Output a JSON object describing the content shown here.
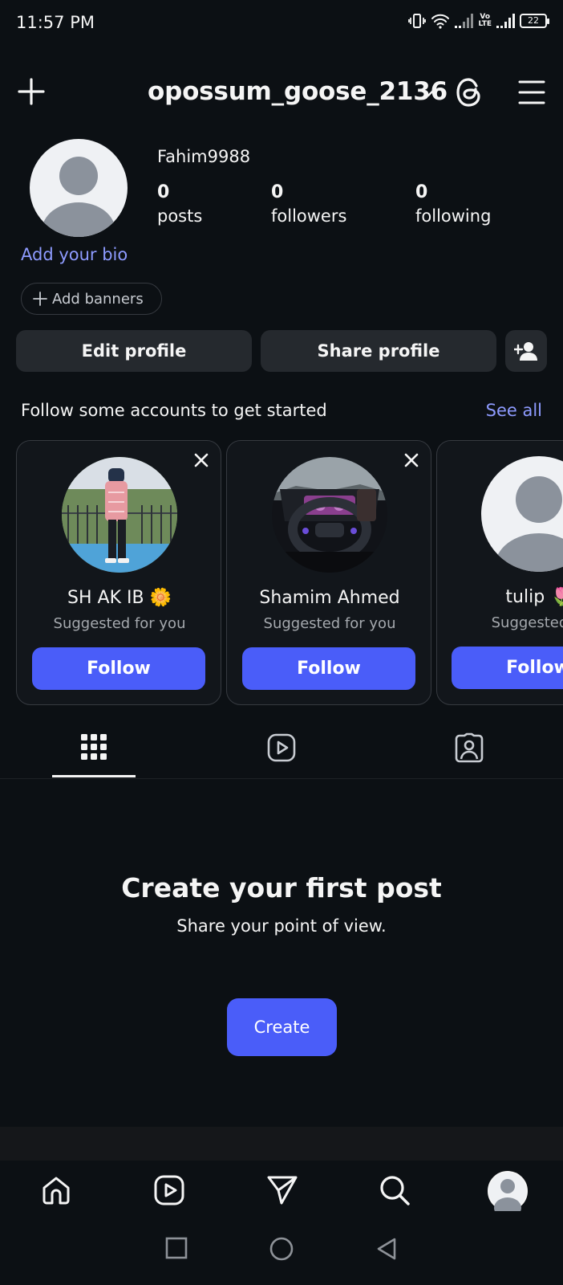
{
  "status_bar": {
    "time": "11:57 PM",
    "battery": "22",
    "volte_top": "Vo",
    "volte_bottom": "LTE"
  },
  "header": {
    "username": "opossum_goose_2136"
  },
  "profile": {
    "display_name": "Fahim9988",
    "stats": [
      {
        "value": "0",
        "label": "posts"
      },
      {
        "value": "0",
        "label": "followers"
      },
      {
        "value": "0",
        "label": "following"
      }
    ],
    "add_bio": "Add your bio",
    "add_banners": "Add banners",
    "edit_profile": "Edit profile",
    "share_profile": "Share profile"
  },
  "suggestions": {
    "title": "Follow some accounts to get started",
    "see_all": "See all",
    "cards": [
      {
        "name": "SH AK IB 🌼",
        "subtitle": "Suggested for you",
        "follow": "Follow"
      },
      {
        "name": "Shamim Ahmed",
        "subtitle": "Suggested for you",
        "follow": "Follow"
      },
      {
        "name": "tulip 🌷",
        "subtitle": "Suggested fo",
        "follow": "Follow"
      }
    ]
  },
  "empty_state": {
    "title": "Create your first post",
    "subtitle": "Share your point of view.",
    "button": "Create"
  },
  "colors": {
    "background": "#0c1014",
    "accent": "#4a5df9",
    "link": "#8e9bff",
    "button_gray": "#25292e"
  },
  "icons": {
    "header": [
      "plus-icon",
      "chevron-down-icon",
      "threads-icon",
      "menu-icon"
    ],
    "tabs": [
      "grid-icon",
      "reels-icon",
      "tagged-icon"
    ],
    "bottom_nav": [
      "home-icon",
      "reels-icon",
      "send-icon",
      "search-icon",
      "profile-avatar"
    ],
    "system_nav": [
      "recents-icon",
      "home-circle-icon",
      "back-icon"
    ]
  }
}
